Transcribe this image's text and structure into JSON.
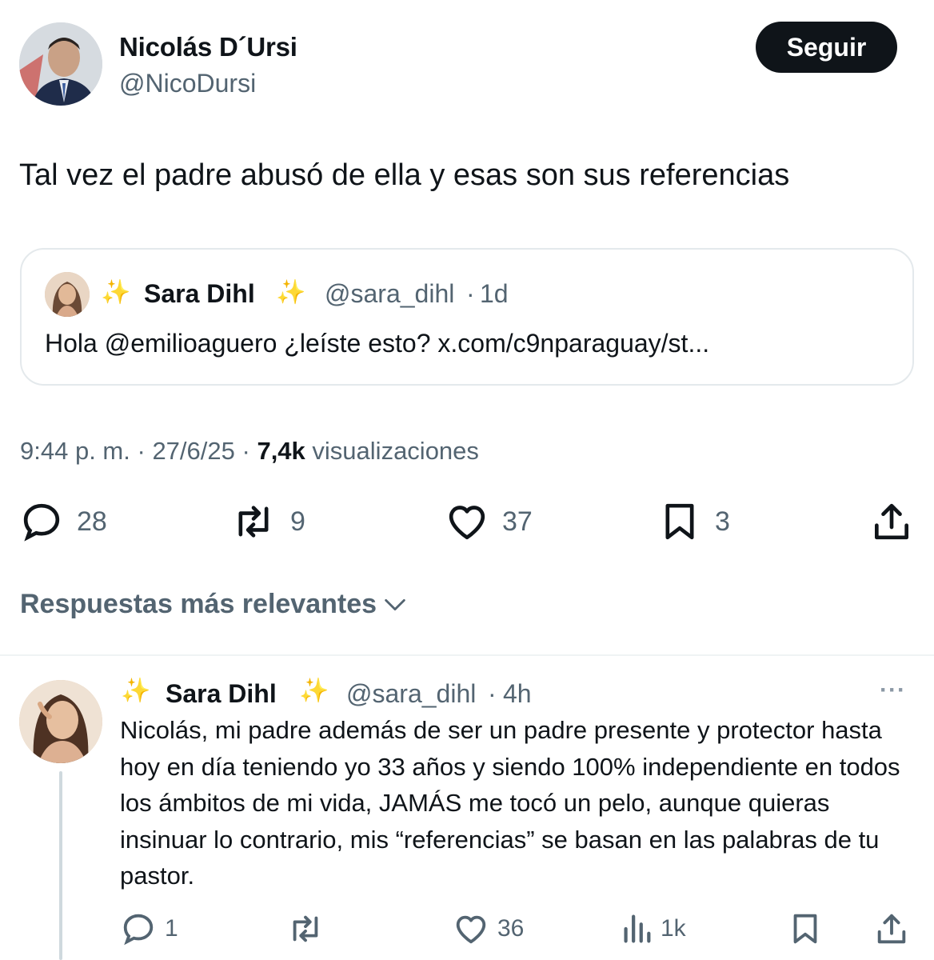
{
  "tweet": {
    "author": {
      "name": "Nicolás D´Ursi",
      "handle": "@NicoDursi",
      "avatar_icon": "profile-photo"
    },
    "follow_label": "Seguir",
    "text": "Tal vez el padre abusó de ella y esas son sus referencias",
    "quote": {
      "name": "Sara Dihl",
      "sparkle_left": "✨",
      "sparkle_right": "✨",
      "handle": "@sara_dihl",
      "separator": "·",
      "time": "1d",
      "text": "Hola @emilioaguero ¿leíste esto? x.com/c9nparaguay/st..."
    },
    "meta": {
      "time": "9:44 p. m.",
      "sep1": "·",
      "date": "27/6/25",
      "sep2": "·",
      "views_count": "7,4k",
      "views_label": "visualizaciones"
    },
    "actions": {
      "replies": "28",
      "retweets": "9",
      "likes": "37",
      "bookmarks": "3"
    }
  },
  "replies_section": {
    "title": "Respuestas más relevantes"
  },
  "reply": {
    "name": "Sara Dihl",
    "sparkle_left": "✨",
    "sparkle_right": "✨",
    "handle": "@sara_dihl",
    "separator": "·",
    "time": "4h",
    "more_label": "···",
    "text": "Nicolás, mi padre además de ser un padre presente y protector hasta hoy en día teniendo yo 33 años y siendo 100% independiente en todos los ámbitos de mi vida, JAMÁS me tocó un pelo, aunque quieras insinuar lo contrario, mis “referencias” se basan en las palabras de tu pastor.",
    "actions": {
      "replies": "1",
      "retweets": "",
      "likes": "36",
      "views": "1k"
    }
  },
  "colors": {
    "accent_dark": "#0f1419",
    "secondary_text": "#536471",
    "border": "#e4e9ec",
    "sparkle": "#f2c230"
  }
}
